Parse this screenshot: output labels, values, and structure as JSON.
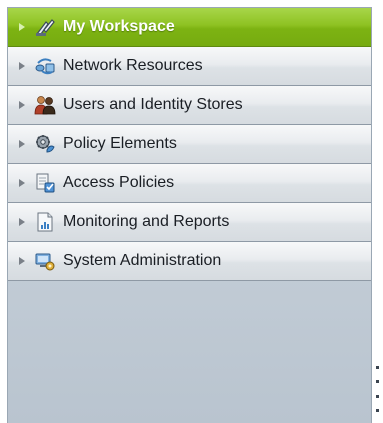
{
  "nav": {
    "items": [
      {
        "label": "My Workspace",
        "icon": "workspace-icon",
        "active": true
      },
      {
        "label": "Network Resources",
        "icon": "network-resources-icon",
        "active": false
      },
      {
        "label": "Users and Identity Stores",
        "icon": "users-icon",
        "active": false
      },
      {
        "label": "Policy Elements",
        "icon": "policy-elements-icon",
        "active": false
      },
      {
        "label": "Access Policies",
        "icon": "access-policies-icon",
        "active": false
      },
      {
        "label": "Monitoring and Reports",
        "icon": "monitoring-reports-icon",
        "active": false
      },
      {
        "label": "System Administration",
        "icon": "system-administration-icon",
        "active": false
      }
    ]
  },
  "colors": {
    "active_item": "#8ec222",
    "panel_background": "#c2ccd6",
    "item_background": "#e9ecef",
    "text": "#1a1e24"
  }
}
